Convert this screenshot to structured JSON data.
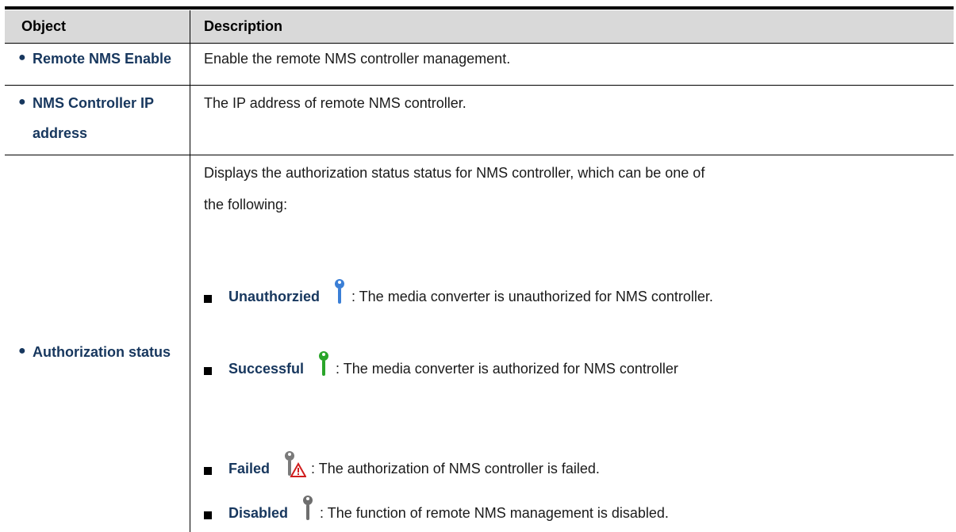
{
  "table": {
    "header": {
      "object": "Object",
      "description": "Description"
    },
    "rows": [
      {
        "object_line1": "Remote NMS Enable",
        "description": "Enable the remote NMS controller management."
      },
      {
        "object_line1": "NMS Controller IP",
        "object_line2": "address",
        "description": "The IP address of remote NMS controller."
      },
      {
        "object_line1": "Authorization status",
        "description_line1": "Displays the authorization status status for NMS controller, which can be one of",
        "description_line2": "the following:",
        "items": [
          {
            "label": "Unauthorzied",
            "text": ": The media converter is unauthorized for NMS controller.",
            "icon": "key-blue-icon",
            "color": "#3b7fd6"
          },
          {
            "label": "Successful",
            "text": ": The media converter is authorized for NMS controller",
            "icon": "key-green-icon",
            "color": "#2aa52a"
          },
          {
            "label": "Failed",
            "text": ": The authorization of NMS controller is failed.",
            "icon": "key-failed-warning-icon",
            "color": "#7a7a7a"
          },
          {
            "label": "Disabled",
            "text": ": The function of remote NMS management is disabled.",
            "icon": "key-gray-icon",
            "color": "#6e6e6e"
          }
        ]
      }
    ]
  },
  "colors": {
    "header_bg": "#d9d9d9",
    "object_text": "#17375e",
    "rule": "#000000"
  }
}
